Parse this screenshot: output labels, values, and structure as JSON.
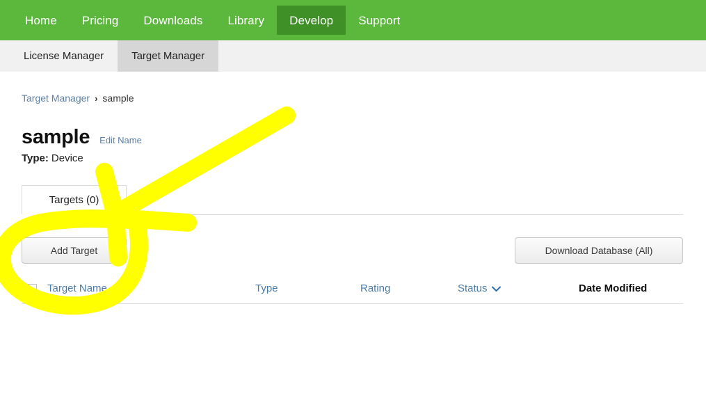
{
  "topnav": {
    "items": [
      {
        "label": "Home",
        "active": false
      },
      {
        "label": "Pricing",
        "active": false
      },
      {
        "label": "Downloads",
        "active": false
      },
      {
        "label": "Library",
        "active": false
      },
      {
        "label": "Develop",
        "active": true
      },
      {
        "label": "Support",
        "active": false
      }
    ],
    "bg_color": "#5cb83c",
    "active_bg_color": "#3f9127"
  },
  "subnav": {
    "items": [
      {
        "label": "License Manager",
        "active": false
      },
      {
        "label": "Target Manager",
        "active": true
      }
    ],
    "bg_color": "#f1f1f1",
    "active_bg_color": "#d6d6d6"
  },
  "breadcrumb": {
    "root_label": "Target Manager",
    "separator": "›",
    "current_label": "sample",
    "link_color": "#5b7fa6"
  },
  "page": {
    "title": "sample",
    "edit_name_label": "Edit Name",
    "type_key": "Type:",
    "type_value": "Device"
  },
  "tabs": {
    "items": [
      {
        "label": "Targets (0)",
        "active": true
      }
    ]
  },
  "actions": {
    "add_target_label": "Add Target",
    "download_database_label": "Download Database (All)"
  },
  "table": {
    "select_all_checkbox": {
      "checked": false
    },
    "columns": [
      {
        "label": "Target Name",
        "sortable": true,
        "sorted": false,
        "sort_icon": ""
      },
      {
        "label": "Type",
        "sortable": true,
        "sorted": false,
        "sort_icon": ""
      },
      {
        "label": "Rating",
        "sortable": true,
        "sorted": false,
        "sort_icon": ""
      },
      {
        "label": "Status",
        "sortable": true,
        "sorted": false,
        "sort_icon": "chevron-down-icon"
      },
      {
        "label": "Date Modified",
        "sortable": false,
        "sorted": true,
        "sort_icon": ""
      }
    ],
    "rows": [],
    "empty": true
  },
  "annotation": {
    "color": "#ffff00",
    "shapes": [
      "arrow-pointing-to-add-target",
      "oval-circling-add-target"
    ]
  }
}
